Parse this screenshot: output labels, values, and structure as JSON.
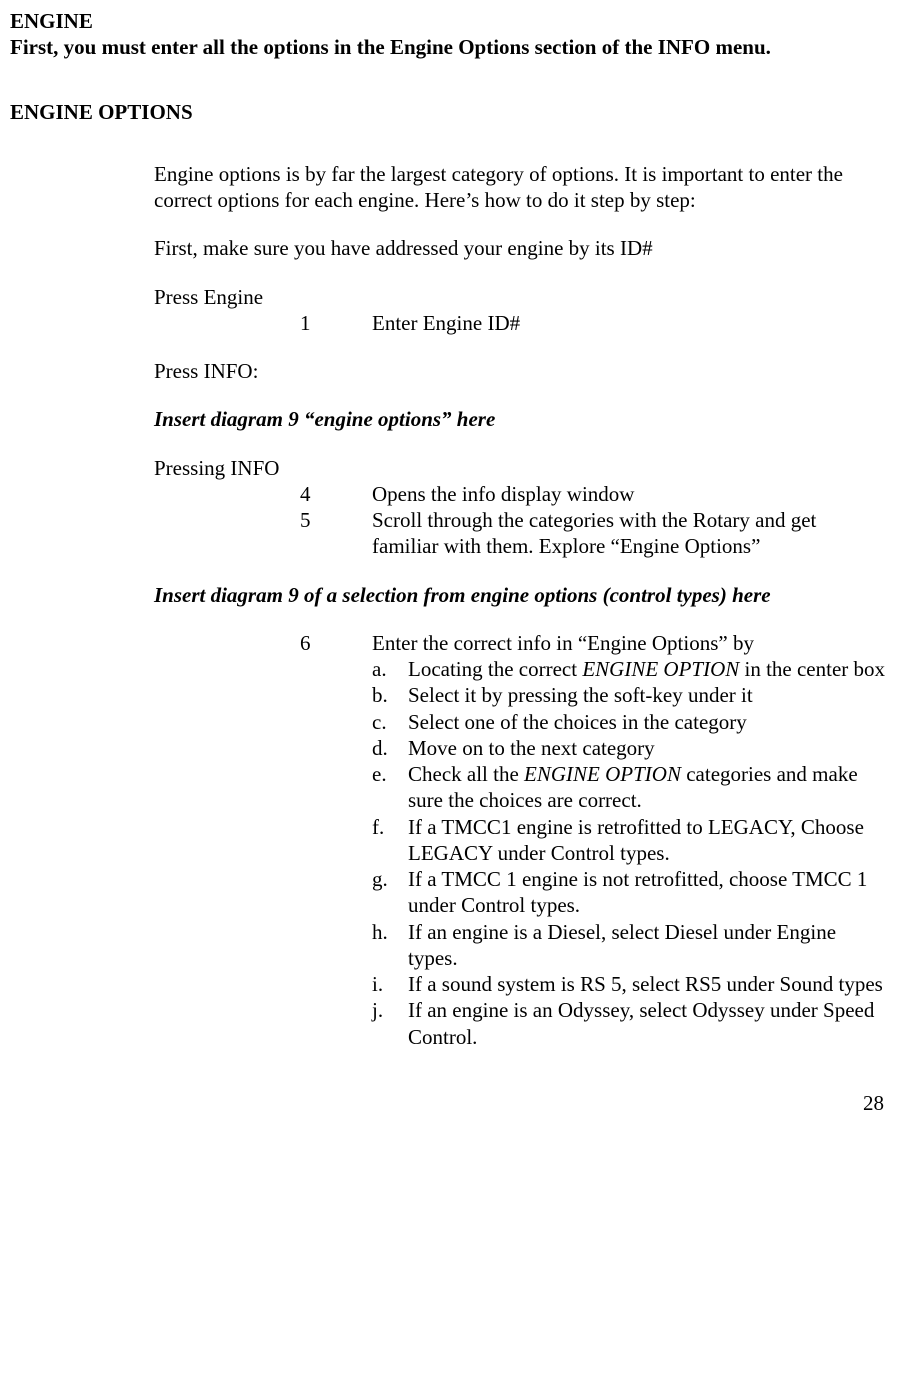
{
  "title": "ENGINE",
  "intro": "First, you must enter all the options in the Engine Options section of the INFO menu.",
  "section_heading": "ENGINE OPTIONS",
  "p1": "Engine options is by far the largest category of options. It is important to enter the correct options for each engine. Here’s how to do it step by step:",
  "p2": "First, make sure you have addressed your engine by its ID#",
  "press_engine": "Press Engine",
  "step1_num": "1",
  "step1_text": "Enter Engine ID#",
  "press_info": "Press INFO:",
  "diagram9a": "Insert diagram 9 “engine options” here",
  "pressing_info": "Pressing INFO",
  "step4_num": "4",
  "step4_text": "Opens the info display window",
  "step5_num": "5",
  "step5_text": "Scroll through the categories with the Rotary and get familiar with them. Explore “Engine Options”",
  "diagram9b": "Insert diagram 9 of a selection from engine options (control types) here",
  "step6_num": "6",
  "step6_text": "Enter the correct info in “Engine Options” by",
  "a_label": "a.",
  "a_pre": "Locating the correct ",
  "a_em": "ENGINE OPTION",
  "a_post": " in the center box",
  "b_label": "b.",
  "b_text": "Select it by pressing the soft-key under it",
  "c_label": "c.",
  "c_text": "Select one of the choices in the category",
  "d_label": "d.",
  "d_text": "Move on to the next category",
  "e_label": "e.",
  "e_pre": "Check all the ",
  "e_em": "ENGINE OPTION",
  "e_post": " categories and make sure the choices are correct.",
  "f_label": "f.",
  "f_text": "If a TMCC1 engine is retrofitted to LEGACY, Choose LEGACY under Control types.",
  "g_label": "g.",
  "g_text": "If a TMCC 1 engine is not retrofitted, choose TMCC 1 under Control types.",
  "h_label": "h.",
  "h_text": "If an engine is a Diesel, select Diesel under Engine types.",
  "i_label": "i.",
  "i_text": "If a sound system is RS 5, select RS5 under Sound types",
  "j_label": "j.",
  "j_text": "If an engine is an Odyssey, select Odyssey under Speed Control.",
  "page_number": "28"
}
